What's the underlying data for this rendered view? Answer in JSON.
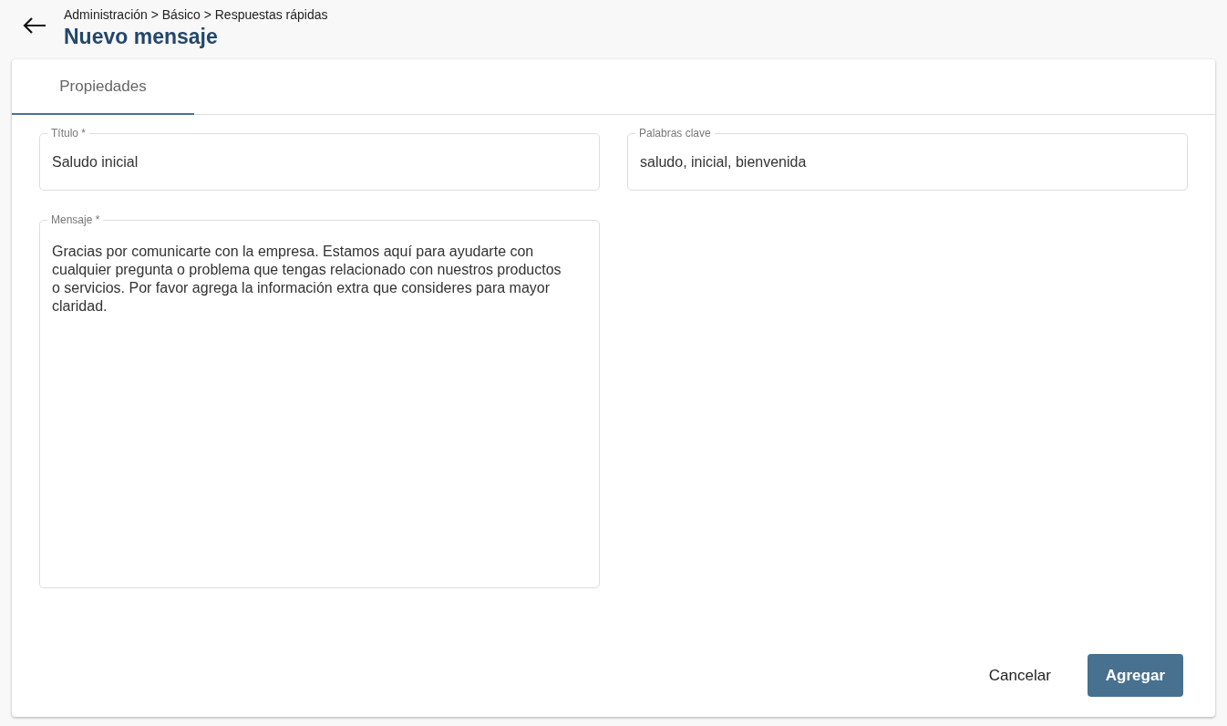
{
  "header": {
    "breadcrumb": "Administración > Básico > Respuestas rápidas",
    "title": "Nuevo mensaje"
  },
  "tabs": [
    {
      "label": "Propiedades",
      "selected": true
    }
  ],
  "fields": [
    {
      "label": "Título *",
      "value": "Saludo inicial",
      "kind": "input"
    },
    {
      "label": "Palabras clave",
      "value": "saludo, inicial, bienvenida",
      "kind": "input"
    },
    {
      "label": "Mensaje *",
      "value": "Gracias por comunicarte con la empresa. Estamos aquí para ayudarte con cualquier pregunta o problema que tengas relacionado con nuestros productos o servicios. Por favor agrega la información extra que consideres para mayor claridad.",
      "kind": "textarea"
    }
  ],
  "buttons": [
    {
      "label": "Cancelar",
      "kind": "text"
    },
    {
      "label": "Agregar",
      "kind": "primary"
    }
  ]
}
